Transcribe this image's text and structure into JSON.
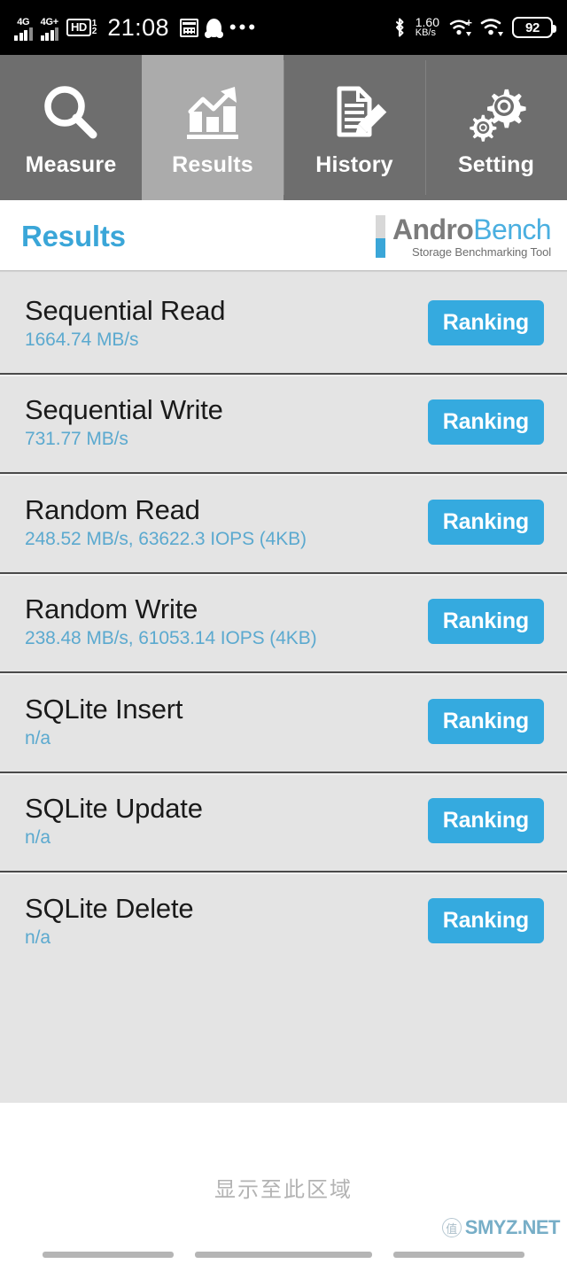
{
  "statusbar": {
    "network_1": "4G",
    "network_2": "4G+",
    "hd_label": "HD",
    "hd_num_top": "1",
    "hd_num_bottom": "2",
    "time": "21:08",
    "icons_left": [
      "signal-4g-icon",
      "signal-4g-plus-icon",
      "volte-hd-icon",
      "calendar-icon",
      "qq-icon",
      "more-dots-icon"
    ],
    "net_speed_value": "1.60",
    "net_speed_unit": "KB/s",
    "icons_right": [
      "bluetooth-icon",
      "wifi-plus-icon",
      "wifi-icon"
    ],
    "battery_level": "92"
  },
  "tabs": [
    {
      "label": "Measure",
      "icon": "magnifier-icon",
      "active": false
    },
    {
      "label": "Results",
      "icon": "bar-chart-trend-icon",
      "active": true
    },
    {
      "label": "History",
      "icon": "document-pencil-icon",
      "active": false
    },
    {
      "label": "Setting",
      "icon": "gears-icon",
      "active": false
    }
  ],
  "header": {
    "title": "Results",
    "logo_andro": "Andro",
    "logo_bench": "Bench",
    "logo_subtitle": "Storage Benchmarking Tool"
  },
  "results": {
    "ranking_label": "Ranking",
    "rows": [
      {
        "title": "Sequential Read",
        "value": "1664.74 MB/s"
      },
      {
        "title": "Sequential Write",
        "value": "731.77 MB/s"
      },
      {
        "title": "Random Read",
        "value": "248.52 MB/s, 63622.3 IOPS (4KB)"
      },
      {
        "title": "Random Write",
        "value": "238.48 MB/s, 61053.14 IOPS (4KB)"
      },
      {
        "title": "SQLite Insert",
        "value": "n/a"
      },
      {
        "title": "SQLite Update",
        "value": "n/a"
      },
      {
        "title": "SQLite Delete",
        "value": "n/a"
      }
    ]
  },
  "footer": {
    "scroll_hint": "显示至此区域",
    "watermark_badge": "值",
    "watermark_text": "SMYZ.NET"
  },
  "colors": {
    "accent_blue": "#35aadf",
    "title_blue": "#3aa6d8",
    "value_blue": "#5ba9cf",
    "tab_inactive": "#6e6e6e",
    "tab_active": "#ababab",
    "list_bg": "#e4e4e4"
  }
}
